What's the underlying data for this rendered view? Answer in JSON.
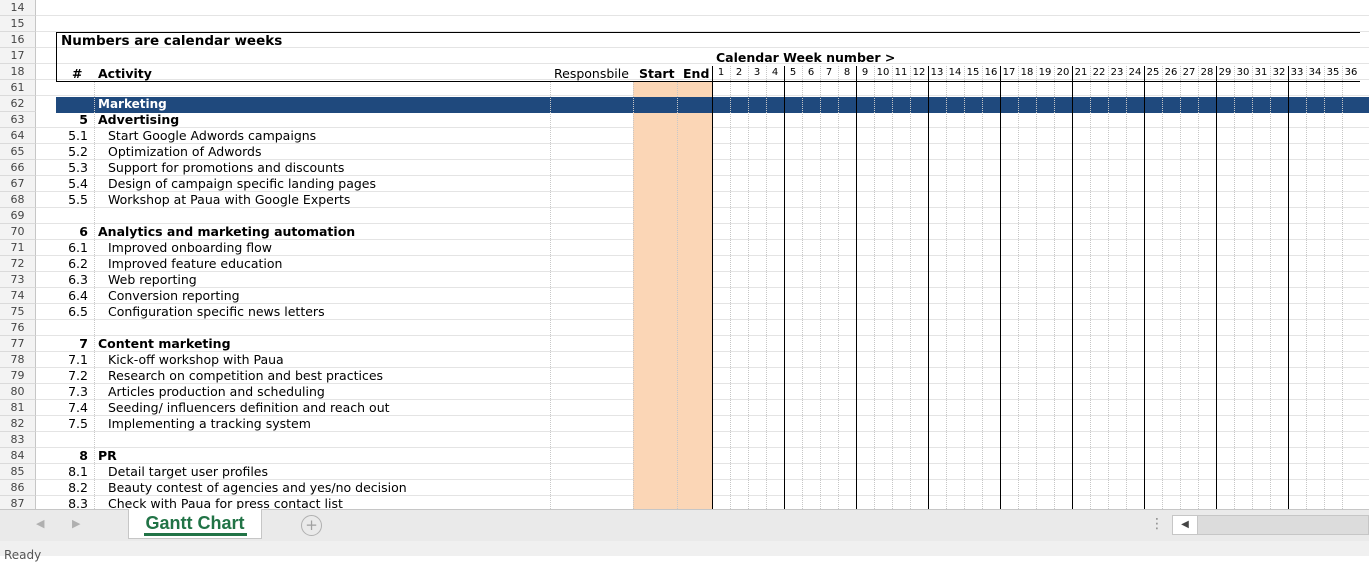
{
  "sheet": {
    "header_row_16": "Numbers are calendar weeks",
    "cal_week_label": "Calendar Week number >",
    "col_hash": "#",
    "col_activity": "Activity",
    "col_responsible": "Responsbile",
    "col_start": "Start",
    "col_end": "End",
    "weeks": [
      "1",
      "2",
      "3",
      "4",
      "5",
      "6",
      "7",
      "8",
      "9",
      "10",
      "11",
      "12",
      "13",
      "14",
      "15",
      "16",
      "17",
      "18",
      "19",
      "20",
      "21",
      "22",
      "23",
      "24",
      "25",
      "26",
      "27",
      "28",
      "29",
      "30",
      "31",
      "32",
      "33",
      "34",
      "35",
      "36"
    ],
    "rows": [
      {
        "rn": "14",
        "num": "",
        "act": "",
        "type": "blank"
      },
      {
        "rn": "15",
        "num": "",
        "act": "",
        "type": "blank"
      },
      {
        "rn": "16",
        "num": "",
        "act": "",
        "type": "title"
      },
      {
        "rn": "17",
        "num": "",
        "act": "",
        "type": "hdr"
      },
      {
        "rn": "18",
        "num": "",
        "act": "",
        "type": "hdr"
      },
      {
        "rn": "61",
        "num": "",
        "act": "",
        "type": "blank"
      },
      {
        "rn": "62",
        "num": "",
        "act": "Marketing",
        "type": "section"
      },
      {
        "rn": "63",
        "num": "5",
        "act": "Advertising",
        "type": "group"
      },
      {
        "rn": "64",
        "num": "5.1",
        "act": "Start Google Adwords campaigns",
        "type": "item"
      },
      {
        "rn": "65",
        "num": "5.2",
        "act": "Optimization of Adwords",
        "type": "item"
      },
      {
        "rn": "66",
        "num": "5.3",
        "act": "Support for promotions and discounts",
        "type": "item"
      },
      {
        "rn": "67",
        "num": "5.4",
        "act": "Design of campaign specific landing pages",
        "type": "item"
      },
      {
        "rn": "68",
        "num": "5.5",
        "act": "Workshop at Paua with Google Experts",
        "type": "item"
      },
      {
        "rn": "69",
        "num": "",
        "act": "",
        "type": "blank"
      },
      {
        "rn": "70",
        "num": "6",
        "act": "Analytics and marketing automation",
        "type": "group"
      },
      {
        "rn": "71",
        "num": "6.1",
        "act": "Improved onboarding flow",
        "type": "item"
      },
      {
        "rn": "72",
        "num": "6.2",
        "act": "Improved feature education",
        "type": "item"
      },
      {
        "rn": "73",
        "num": "6.3",
        "act": "Web reporting",
        "type": "item"
      },
      {
        "rn": "74",
        "num": "6.4",
        "act": "Conversion reporting",
        "type": "item"
      },
      {
        "rn": "75",
        "num": "6.5",
        "act": "Configuration specific news letters",
        "type": "item"
      },
      {
        "rn": "76",
        "num": "",
        "act": "",
        "type": "blank"
      },
      {
        "rn": "77",
        "num": "7",
        "act": "Content marketing",
        "type": "group"
      },
      {
        "rn": "78",
        "num": "7.1",
        "act": "Kick-off workshop with Paua",
        "type": "item"
      },
      {
        "rn": "79",
        "num": "7.2",
        "act": "Research on competition and best practices",
        "type": "item"
      },
      {
        "rn": "80",
        "num": "7.3",
        "act": "Articles production and scheduling",
        "type": "item"
      },
      {
        "rn": "81",
        "num": "7.4",
        "act": "Seeding/ influencers definition and reach out",
        "type": "item"
      },
      {
        "rn": "82",
        "num": "7.5",
        "act": "Implementing a tracking system",
        "type": "item"
      },
      {
        "rn": "83",
        "num": "",
        "act": "",
        "type": "blank"
      },
      {
        "rn": "84",
        "num": "8",
        "act": "PR",
        "type": "group"
      },
      {
        "rn": "85",
        "num": "8.1",
        "act": "Detail target user profiles",
        "type": "item"
      },
      {
        "rn": "86",
        "num": "8.2",
        "act": "Beauty contest of agencies and yes/no decision",
        "type": "item"
      },
      {
        "rn": "87",
        "num": "8.3",
        "act": "Check with Paua for press contact list",
        "type": "item"
      }
    ]
  },
  "tabs": {
    "active": "Gantt Chart",
    "add_symbol": "+",
    "prev_symbol": "◀",
    "next_symbol": "▶",
    "more_symbol": "⋮",
    "scroll_left_symbol": "◀"
  },
  "status": {
    "text": "Ready"
  },
  "colors": {
    "section_bar": "#1f497d",
    "startend_fill": "#fbd6b6",
    "tab_text": "#217346"
  }
}
